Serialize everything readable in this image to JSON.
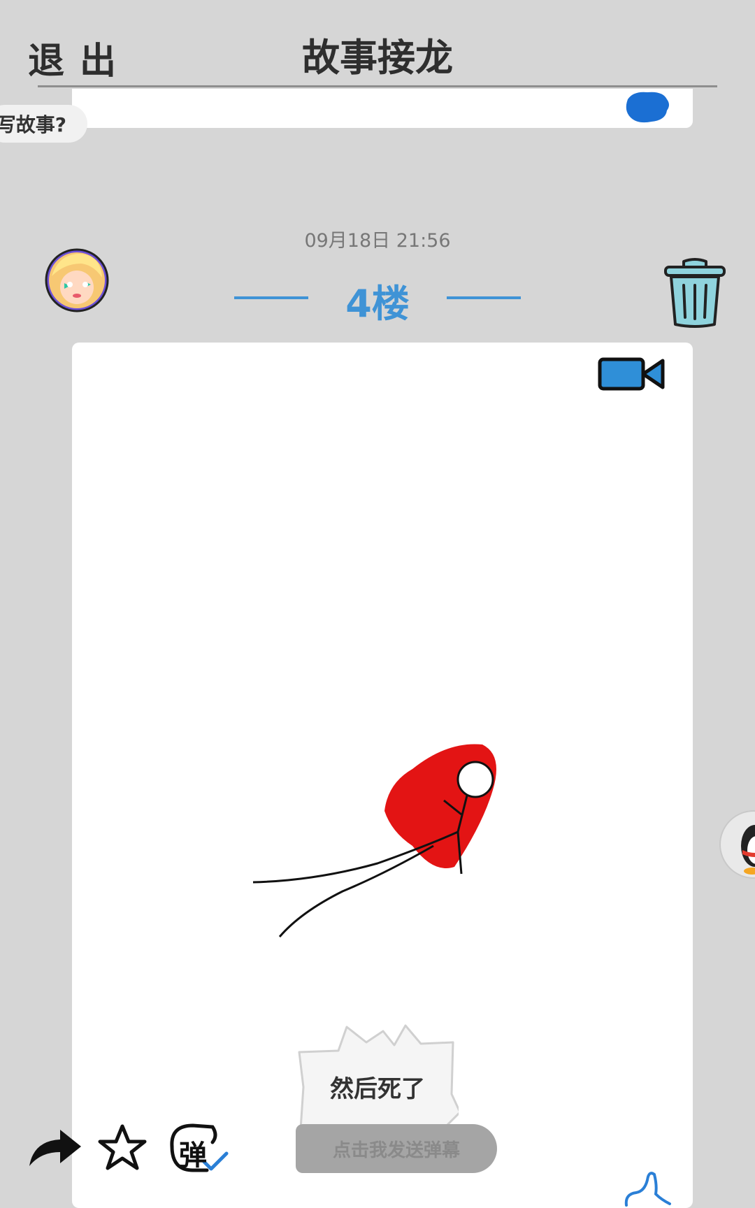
{
  "header": {
    "exit_label": "退出",
    "title": "故事接龙"
  },
  "floating_pill": {
    "label": "写故事?"
  },
  "post": {
    "timestamp": "09月18日  21:56",
    "floor_label": "4楼",
    "comment_text": "然后死了"
  },
  "danmaku": {
    "placeholder": "点击我发送弹幕",
    "toggle_label": "弹"
  },
  "colors": {
    "accent_blue": "#3f93d6",
    "background": "#d6d6d6",
    "trash_fill": "#8fd3dd",
    "drawing_red": "#e31414"
  },
  "icons": [
    "share-icon",
    "star-icon",
    "danmaku-toggle-icon",
    "video-icon",
    "trash-icon",
    "pen-icon",
    "qq-icon",
    "avatar"
  ]
}
